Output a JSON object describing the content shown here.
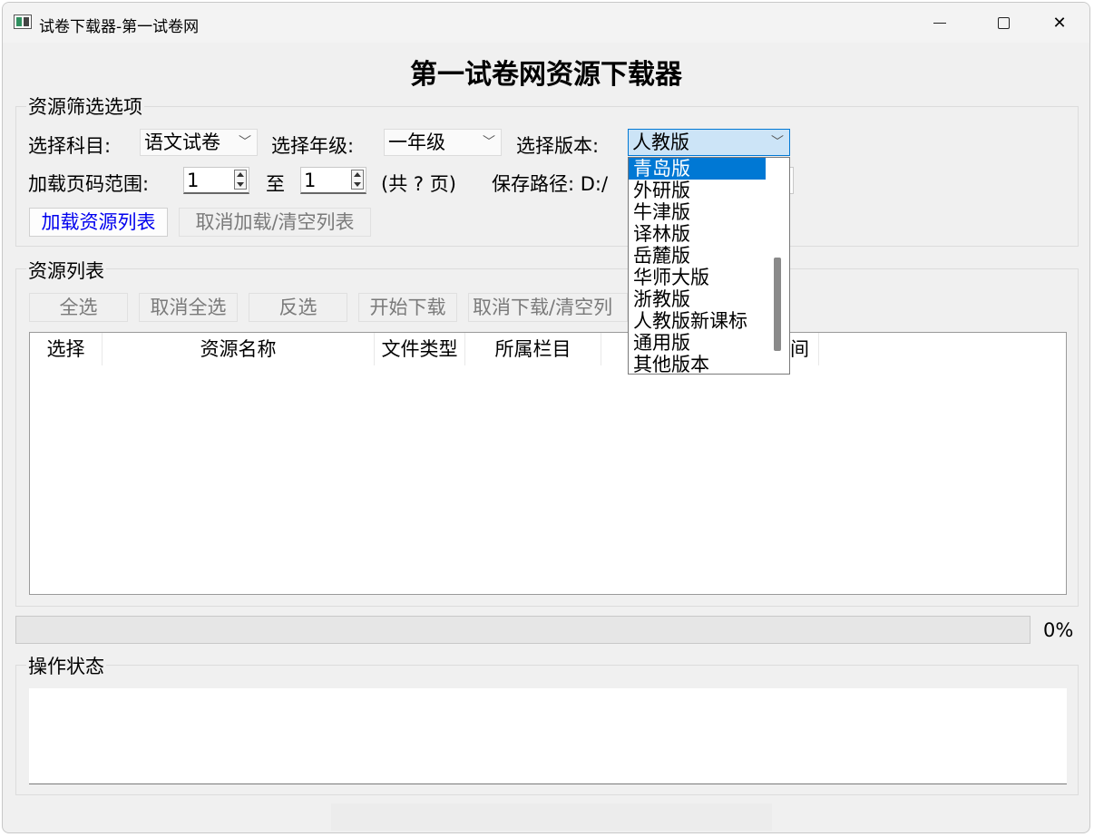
{
  "window": {
    "title": "试卷下载器-第一试卷网"
  },
  "main_title": "第一试卷网资源下载器",
  "filter": {
    "group_label": "资源筛选选项",
    "subject_label": "选择科目:",
    "subject_value": "语文试卷",
    "grade_label": "选择年级:",
    "grade_value": "一年级",
    "edition_label": "选择版本:",
    "edition_value": "人教版",
    "page_range_label": "加载页码范围:",
    "page_from": "1",
    "to_label": "至",
    "page_to": "1",
    "total_pages": "(共 ? 页)",
    "save_path_label": "保存路径: D:/",
    "load_button": "加载资源列表",
    "cancel_button": "取消加载/清空列表"
  },
  "edition_dropdown": {
    "options": [
      "青岛版",
      "外研版",
      "牛津版",
      "译林版",
      "岳麓版",
      "华师大版",
      "浙教版",
      "人教版新课标",
      "通用版",
      "其他版本"
    ],
    "highlighted_index": 0
  },
  "resources": {
    "group_label": "资源列表",
    "buttons": {
      "select_all": "全选",
      "deselect_all": "取消全选",
      "invert": "反选",
      "start_download": "开始下载",
      "cancel_download": "取消下载/清空列"
    },
    "columns": [
      "选择",
      "资源名称",
      "文件类型",
      "所属栏目",
      "",
      "间"
    ]
  },
  "progress": {
    "value": 0,
    "label": "0%"
  },
  "status": {
    "group_label": "操作状态"
  },
  "icons": {
    "app": "app-window-icon",
    "minimize": "minimize-icon",
    "maximize": "maximize-icon",
    "close": "close-icon",
    "combo_arrow": "chevron-down-icon"
  }
}
